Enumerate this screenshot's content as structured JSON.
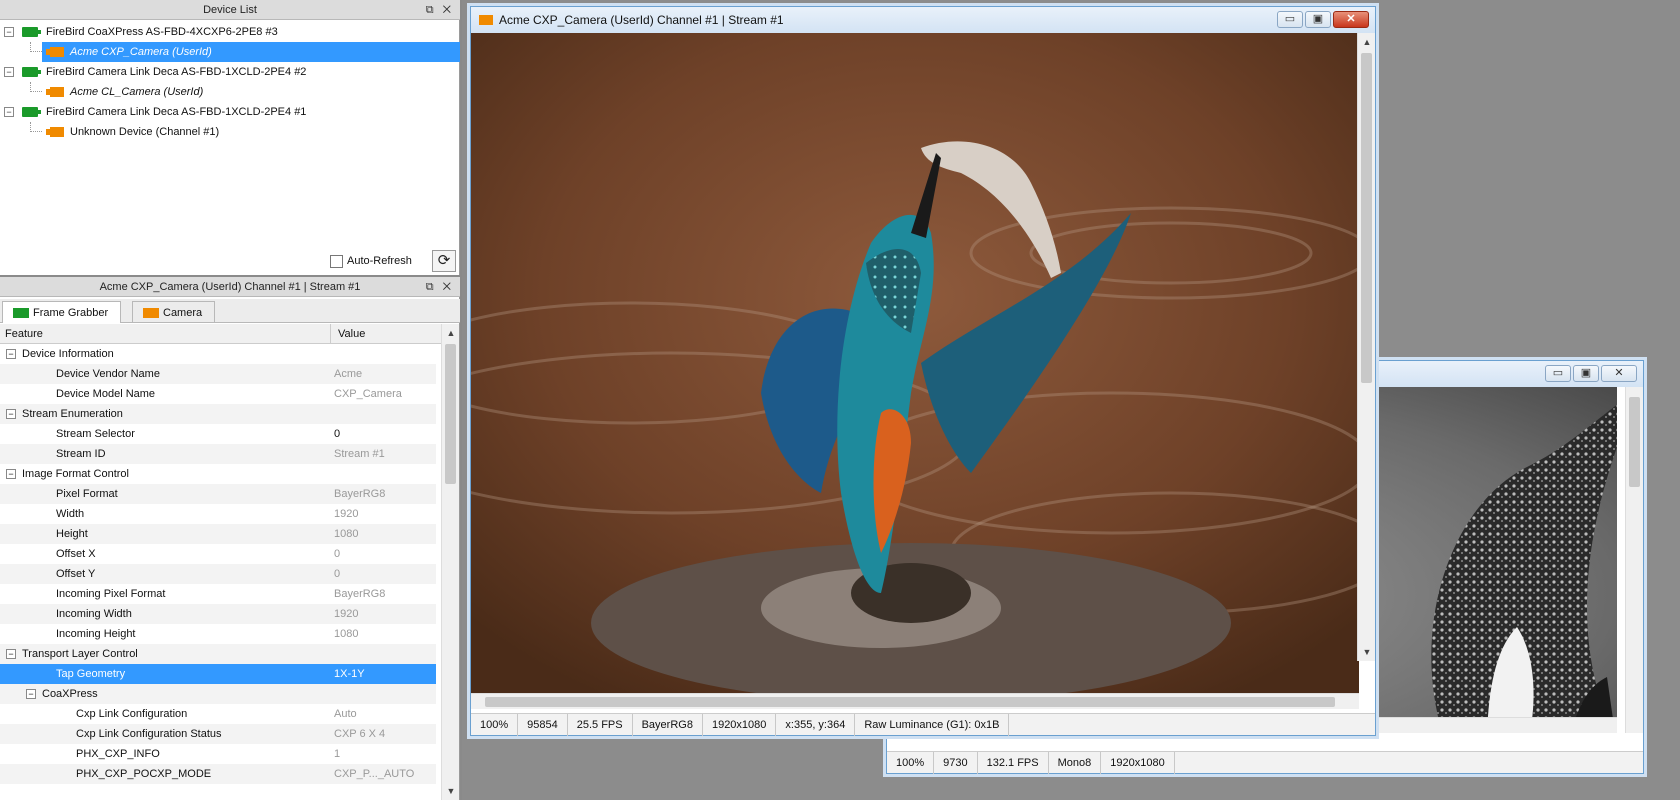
{
  "device_list": {
    "title": "Device List",
    "buttons": "⧉ ✕",
    "items": [
      {
        "label": "FireBird CoaXPress AS-FBD-4XCXP6-2PE8 #3",
        "kind": "device",
        "expander": "−"
      },
      {
        "label": "Acme CXP_Camera (UserId)",
        "kind": "camera",
        "selected": true
      },
      {
        "label": "FireBird Camera Link Deca AS-FBD-1XCLD-2PE4 #2",
        "kind": "device",
        "expander": "−"
      },
      {
        "label": "Acme CL_Camera (UserId)",
        "kind": "camera"
      },
      {
        "label": "FireBird Camera Link Deca AS-FBD-1XCLD-2PE4 #1",
        "kind": "device",
        "expander": "−"
      },
      {
        "label": "Unknown Device (Channel #1)",
        "kind": "camera"
      }
    ],
    "auto_refresh_label": "Auto-Refresh",
    "auto_refresh_checked": false,
    "refresh_icon": "⟳"
  },
  "feature_panel": {
    "title": "Acme CXP_Camera (UserId) Channel #1 | Stream #1",
    "buttons": "⧉ ✕",
    "tabs": [
      {
        "label": "Frame Grabber",
        "icon": "frame-grabber-icon",
        "active": true
      },
      {
        "label": "Camera",
        "icon": "camera-icon",
        "active": false
      }
    ],
    "col_feature": "Feature",
    "col_value": "Value",
    "rows": [
      {
        "name": "Device Information",
        "value": "",
        "level": 0,
        "cat": true
      },
      {
        "name": "Device Vendor Name",
        "value": "Acme",
        "level": 1
      },
      {
        "name": "Device Model Name",
        "value": "CXP_Camera",
        "level": 1
      },
      {
        "name": "Stream Enumeration",
        "value": "",
        "level": 0,
        "cat": true
      },
      {
        "name": "Stream Selector",
        "value": "0",
        "level": 1,
        "editable": true
      },
      {
        "name": "Stream ID",
        "value": "Stream #1",
        "level": 1
      },
      {
        "name": "Image Format Control",
        "value": "",
        "level": 0,
        "cat": true
      },
      {
        "name": "Pixel Format",
        "value": "BayerRG8",
        "level": 1
      },
      {
        "name": "Width",
        "value": "1920",
        "level": 1
      },
      {
        "name": "Height",
        "value": "1080",
        "level": 1
      },
      {
        "name": "Offset X",
        "value": "0",
        "level": 1
      },
      {
        "name": "Offset Y",
        "value": "0",
        "level": 1
      },
      {
        "name": "Incoming Pixel Format",
        "value": "BayerRG8",
        "level": 1
      },
      {
        "name": "Incoming Width",
        "value": "1920",
        "level": 1
      },
      {
        "name": "Incoming Height",
        "value": "1080",
        "level": 1
      },
      {
        "name": "Transport Layer Control",
        "value": "",
        "level": 0,
        "cat": true
      },
      {
        "name": "Tap Geometry",
        "value": "1X-1Y",
        "level": 1,
        "selected": true
      },
      {
        "name": "CoaXPress",
        "value": "",
        "level": 1,
        "cat": true
      },
      {
        "name": "Cxp Link Configuration",
        "value": "Auto",
        "level": 2
      },
      {
        "name": "Cxp Link Configuration Status",
        "value": "CXP 6 X 4",
        "level": 2
      },
      {
        "name": "PHX_CXP_INFO",
        "value": "1",
        "level": 2
      },
      {
        "name": "PHX_CXP_POCXP_MODE",
        "value": "CXP_P..._AUTO",
        "level": 2
      }
    ]
  },
  "stream_window": {
    "title": "Acme CXP_Camera (UserId) Channel #1 | Stream #1",
    "status": [
      "100%",
      "95854",
      "25.5 FPS",
      "BayerRG8",
      "1920x1080",
      "x:355, y:364",
      "Raw Luminance (G1): 0x1B"
    ]
  },
  "stream_window_2": {
    "title": "",
    "status": [
      "100%",
      "9730",
      "132.1 FPS",
      "Mono8",
      "1920x1080"
    ]
  },
  "window_buttons": {
    "minimize": "▭",
    "maximize": "▣",
    "close": "✕"
  }
}
